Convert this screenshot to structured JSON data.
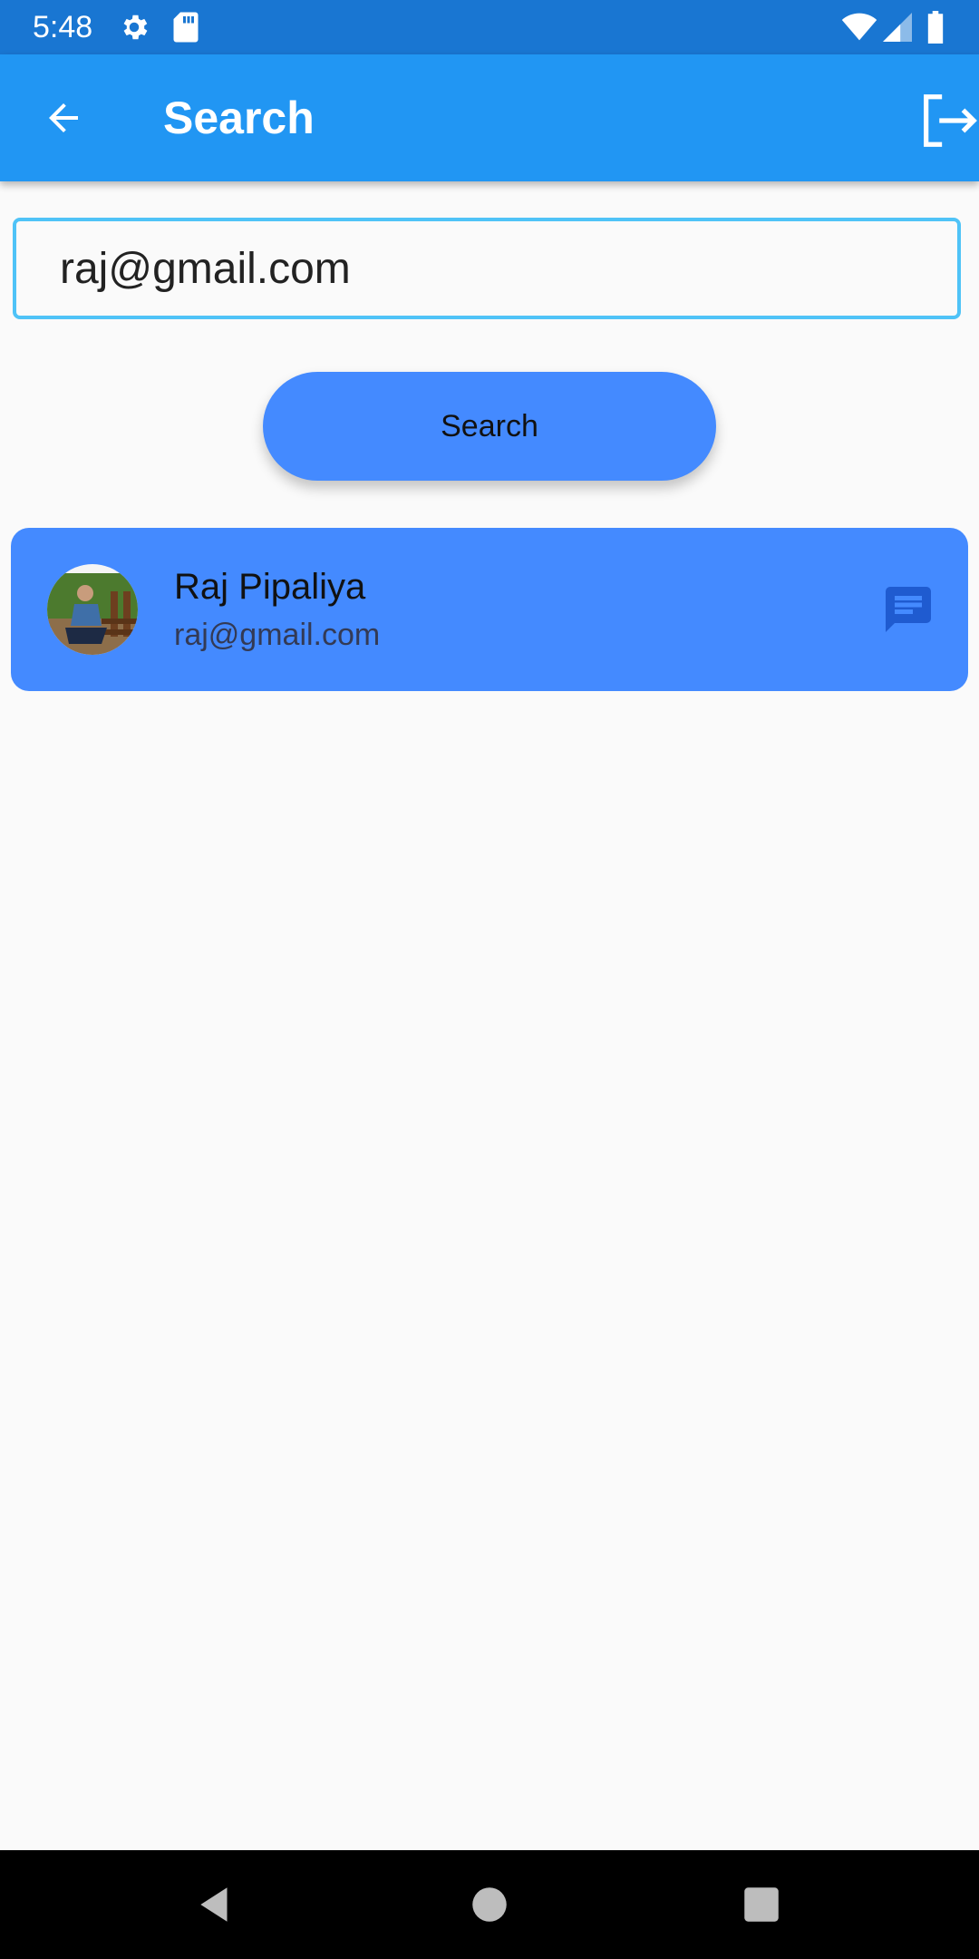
{
  "status_bar": {
    "time": "5:48",
    "icons": [
      "gear-icon",
      "sd-card-icon",
      "wifi-icon",
      "cell-signal-icon",
      "battery-icon"
    ],
    "background": "#1976d2"
  },
  "app_bar": {
    "title": "Search",
    "back_icon": "arrow-left-icon",
    "logout_icon": "logout-icon",
    "background": "#2196f3"
  },
  "search": {
    "value": "raj@gmail.com",
    "border_color": "#4fc3f7",
    "button_label": "Search",
    "button_color": "#448aff"
  },
  "results": [
    {
      "name": "Raj Pipaliya",
      "email": "raj@gmail.com",
      "avatar_icon": "user-photo-avatar",
      "action_icon": "chat-icon"
    }
  ],
  "nav_bar": {
    "icons": [
      "back-triangle-icon",
      "home-circle-icon",
      "recents-square-icon"
    ]
  }
}
